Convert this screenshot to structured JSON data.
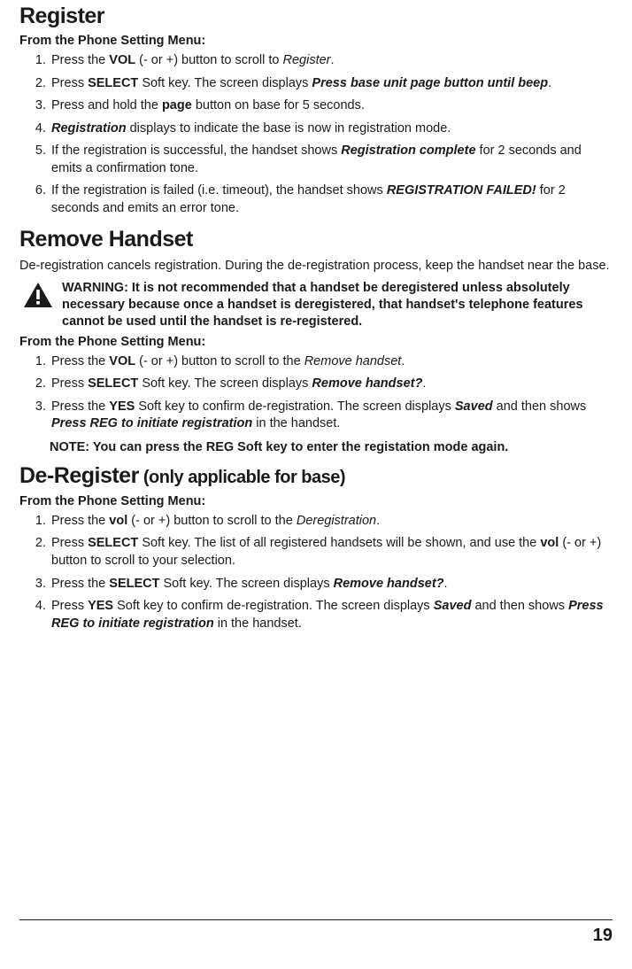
{
  "section1": {
    "title": "Register",
    "menu_label": "From the Phone Setting Menu:",
    "steps": [
      {
        "pre": "Press the ",
        "bold1": "VOL",
        "mid1": " (- or +) button to scroll to ",
        "ital1": "Register",
        "tail": "."
      },
      {
        "pre": "Press ",
        "bold1": "SELECT",
        "mid1": " Soft key. The screen displays ",
        "bital1": "Press base unit page button until beep",
        "tail": "."
      },
      {
        "pre": "Press and hold the ",
        "bold1": "page",
        "mid1": " button on base for 5 seconds.",
        "tail": ""
      },
      {
        "bital_first": "Registration",
        "mid1": " displays to indicate the base is now in registration mode.",
        "tail": ""
      },
      {
        "pre": "If the registration is successful, the handset shows ",
        "bital1": "Registration complete",
        "mid1": " for 2 seconds and emits a confirmation tone.",
        "tail": ""
      },
      {
        "pre": "If the registration is failed (i.e. timeout), the handset shows ",
        "bital1": "REGISTRATION FAILED!",
        "mid1": " for 2 seconds and emits an error tone.",
        "tail": ""
      }
    ]
  },
  "section2": {
    "title": "Remove Handset",
    "intro": "De-registration cancels registration. During the de-registration process, keep the handset near the base.",
    "warning": "WARNING: It is not recommended that a handset be deregistered unless absolutely necessary because once a handset is deregistered, that handset's telephone features cannot be used until the handset is re-registered.",
    "menu_label": "From the Phone Setting Menu:",
    "steps": [
      {
        "pre": "Press the ",
        "bold1": "VOL",
        "mid1": " (- or +) button to scroll to the ",
        "ital1": "Remove handset",
        "tail": "."
      },
      {
        "pre": "Press ",
        "bold1": "SELECT",
        "mid1": " Soft key. The screen displays ",
        "bital1": "Remove handset?",
        "tail": "."
      },
      {
        "pre": "Press the ",
        "bold1": "YES",
        "mid1": " Soft key to confirm de-registration. The screen displays ",
        "bital1": "Saved",
        "mid2": " and then shows ",
        "bital2": "Press REG to initiate registration",
        "tail": " in the handset."
      }
    ],
    "note": "NOTE: You can press the REG Soft key to enter the registation mode again."
  },
  "section3": {
    "title": "De-Register",
    "title_suffix": " (only applicable for base)",
    "menu_label": "From the Phone Setting Menu:",
    "steps": [
      {
        "pre": "Press the ",
        "bold1": "vol",
        "mid1": " (- or +) button to scroll to the ",
        "ital1": "Deregistration",
        "tail": "."
      },
      {
        "pre": "Press ",
        "bold1": "SELECT",
        "mid1": " Soft key. The list of all registered handsets will be shown, and use the ",
        "bold2": "vol",
        "mid2": " (- or +) button to scroll to your selection.",
        "tail": ""
      },
      {
        "pre": "Press the ",
        "bold1": "SELECT",
        "mid1": " Soft key. The screen displays ",
        "bital1": "Remove handset?",
        "tail": "."
      },
      {
        "pre": "Press ",
        "bold1": "YES",
        "mid1": " Soft key to confirm de-registration. The screen displays ",
        "bital1": "Saved",
        "mid2": " and then shows ",
        "bital2": "Press REG to initiate registration",
        "tail": " in the handset."
      }
    ]
  },
  "page_number": "19"
}
